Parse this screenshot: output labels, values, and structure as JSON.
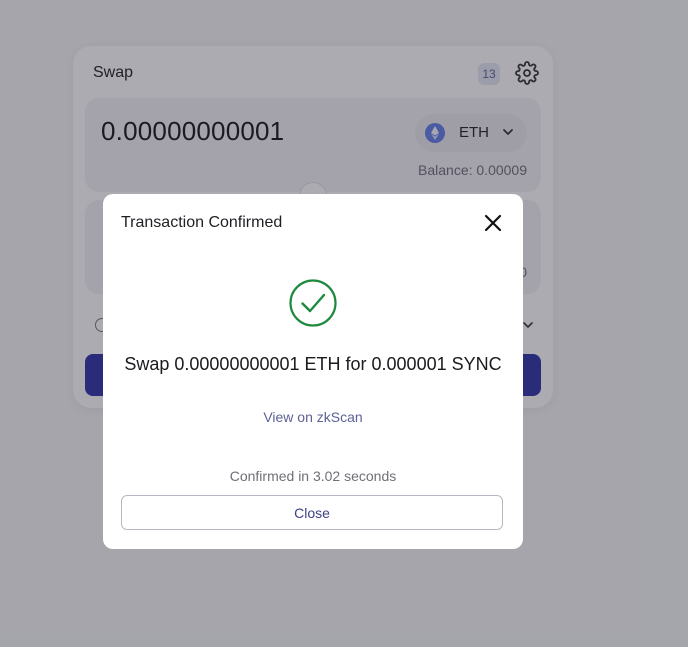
{
  "swap_card": {
    "title": "Swap",
    "tx_count": "13",
    "input": {
      "amount": "0.00000000001",
      "token": "ETH",
      "balance": "Balance: 0.00009"
    },
    "output": {
      "balance_tail": "0"
    }
  },
  "modal": {
    "title": "Transaction Confirmed",
    "summary": "Swap 0.00000000001 ETH for 0.000001 SYNC",
    "view_link": "View on zkScan",
    "confirmed_time": "Confirmed in 3.02 seconds",
    "close_label": "Close"
  },
  "colors": {
    "accent": "#2e33a5",
    "success": "#1e8a3e",
    "link": "#5d6196",
    "eth": "#627eea"
  },
  "icons": {
    "settings": "gear-icon",
    "close": "close-icon",
    "success": "check-circle-icon",
    "token": "eth-icon",
    "dropdown": "chevron-down-icon"
  }
}
